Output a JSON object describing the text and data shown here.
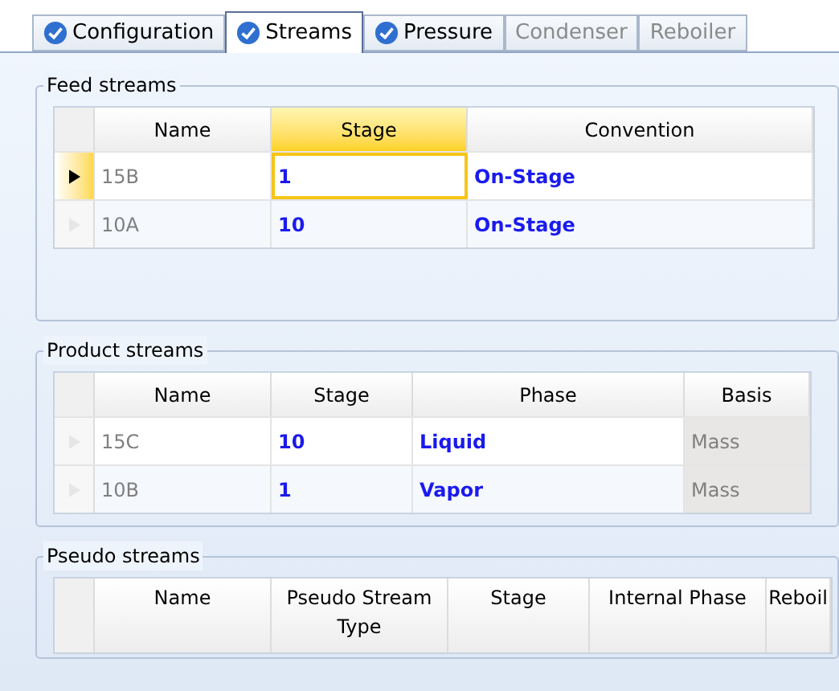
{
  "tabs": [
    {
      "label": "Configuration",
      "selected": false,
      "complete": true
    },
    {
      "label": "Streams",
      "selected": true,
      "complete": true
    },
    {
      "label": "Pressure",
      "selected": false,
      "complete": true
    },
    {
      "label": "Condenser",
      "selected": false,
      "complete": false
    },
    {
      "label": "Reboiler",
      "selected": false,
      "complete": false
    }
  ],
  "groups": [
    {
      "title": "Feed streams",
      "columns": [
        {
          "label": "Name",
          "kind": "name",
          "selected": false
        },
        {
          "label": "Stage",
          "kind": "value",
          "selected": true
        },
        {
          "label": "Convention",
          "kind": "value",
          "selected": false
        }
      ],
      "rows": [
        {
          "current": true,
          "cells": [
            "15B",
            "1",
            "On-Stage"
          ]
        },
        {
          "current": false,
          "cells": [
            "10A",
            "10",
            "On-Stage"
          ]
        }
      ]
    },
    {
      "title": "Product streams",
      "columns": [
        {
          "label": "Name",
          "kind": "name",
          "selected": false
        },
        {
          "label": "Stage",
          "kind": "value",
          "selected": false
        },
        {
          "label": "Phase",
          "kind": "value",
          "selected": false
        },
        {
          "label": "Basis",
          "kind": "readonly",
          "selected": false
        }
      ],
      "rows": [
        {
          "current": false,
          "cells": [
            "15C",
            "10",
            "Liquid",
            "Mass"
          ]
        },
        {
          "current": false,
          "cells": [
            "10B",
            "1",
            "Vapor",
            "Mass"
          ]
        }
      ]
    },
    {
      "title": "Pseudo streams",
      "columns": [
        {
          "label": "Name",
          "selected": false
        },
        {
          "label": "Pseudo Stream Type",
          "selected": false
        },
        {
          "label": "Stage",
          "selected": false
        },
        {
          "label": "Internal Phase",
          "selected": false
        },
        {
          "label": "Reboil",
          "selected": false
        }
      ]
    }
  ]
}
